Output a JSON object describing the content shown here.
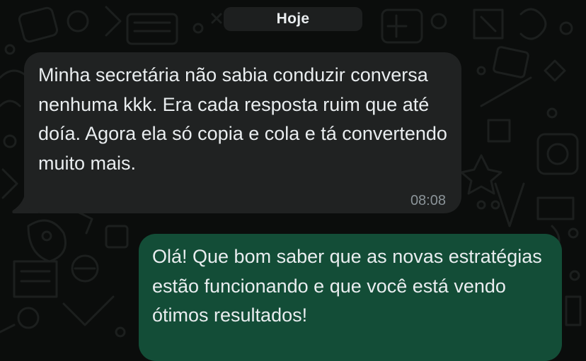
{
  "chat": {
    "date_separator": "Hoje",
    "messages": [
      {
        "direction": "incoming",
        "text": "Minha secretária não sabia conduzir conversa nenhuma kkk. Era cada resposta ruim que até doía. Agora ela só copia e cola e tá convertendo muito mais.",
        "time": "08:08"
      },
      {
        "direction": "outgoing",
        "text": "Olá! Que bom saber que as novas estratégias estão funcionando e que você está vendo ótimos resultados!"
      }
    ]
  },
  "colors": {
    "background": "#0b0d0c",
    "incoming_bubble": "#202222",
    "outgoing_bubble": "#134d37",
    "date_pill": "#1d1f1f",
    "text": "#e9edef",
    "timestamp": "#8b9499"
  }
}
